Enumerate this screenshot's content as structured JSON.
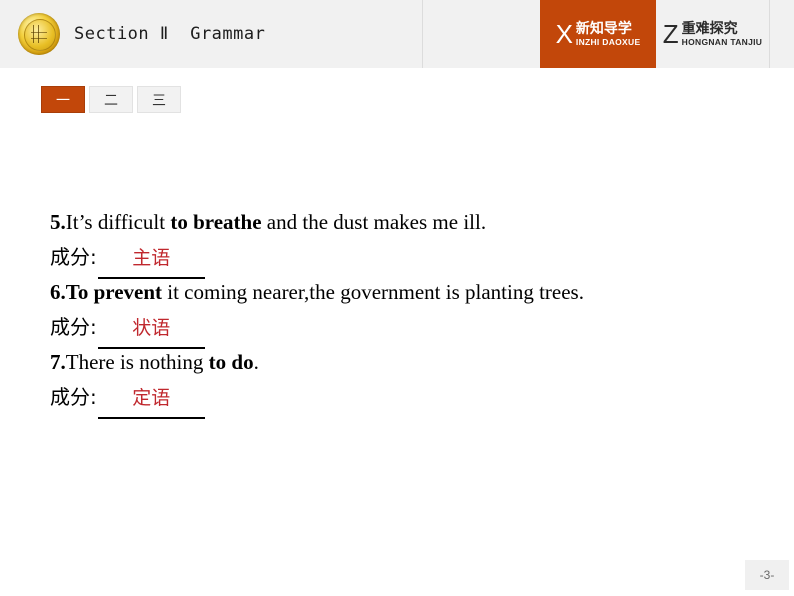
{
  "header": {
    "logo_icon": "gold-seal-icon",
    "section_title": "Section Ⅱ  Grammar",
    "tabs": [
      {
        "letter": "X",
        "chinese": "新知导学",
        "pinyin": "INZHI DAOXUE",
        "active": true,
        "accent": "#c2470a"
      },
      {
        "letter": "Z",
        "chinese": "重难探究",
        "pinyin": "HONGNAN TANJIU",
        "active": false,
        "accent": "#f1f1f1"
      }
    ]
  },
  "number_buttons": [
    {
      "label": "一",
      "active": true
    },
    {
      "label": "二",
      "active": false
    },
    {
      "label": "三",
      "active": false
    }
  ],
  "questions": [
    {
      "number": "5.",
      "pre": "It’s difficult ",
      "bold": "to breathe",
      "post": " and the dust makes me ill.",
      "answer_label": "成分:",
      "answer": "主语"
    },
    {
      "number": "6.",
      "pre": "",
      "bold": "To prevent",
      "post": " it coming nearer,the government is planting trees.",
      "answer_label": "成分:",
      "answer": "状语"
    },
    {
      "number": "7.",
      "pre": "There is nothing ",
      "bold": "to do",
      "post": ".",
      "answer_label": "成分:",
      "answer": "定语"
    }
  ],
  "footer": {
    "page_number": "-3-"
  },
  "colors": {
    "accent_orange": "#c2470a",
    "answer_red": "#c0282e",
    "header_gray": "#f1f1f1"
  }
}
